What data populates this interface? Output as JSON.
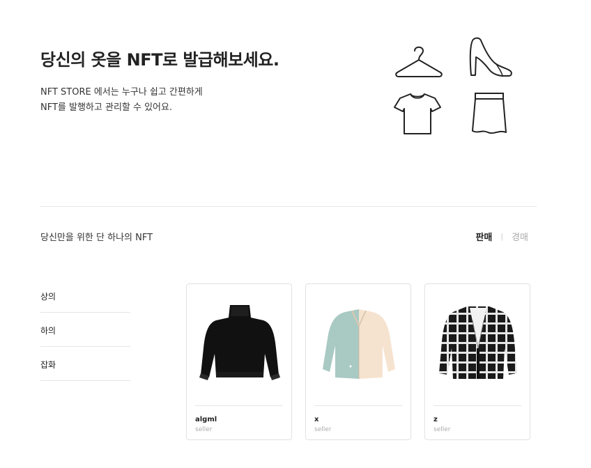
{
  "hero": {
    "title": "당신의 옷을 NFT로 발급해보세요.",
    "desc_line1": "NFT STORE 에서는 누구나 쉽고 간편하게",
    "desc_line2": "NFT를 발행하고 관리할 수 있어요."
  },
  "icons": [
    "hanger-icon",
    "high-heel-icon",
    "t-shirt-icon",
    "skirt-icon"
  ],
  "section": {
    "title": "당신만을 위한 단 하나의 NFT",
    "toggle_active": "판매",
    "toggle_separator": "|",
    "toggle_inactive": "경매"
  },
  "categories": [
    "상의",
    "하의",
    "잡화"
  ],
  "products": [
    {
      "name": "algml",
      "seller": "seller",
      "image": "black-knit-sweater"
    },
    {
      "name": "x",
      "seller": "seller",
      "image": "mint-beige-cardigan"
    },
    {
      "name": "z",
      "seller": "seller",
      "image": "black-plaid-cardigan"
    }
  ]
}
